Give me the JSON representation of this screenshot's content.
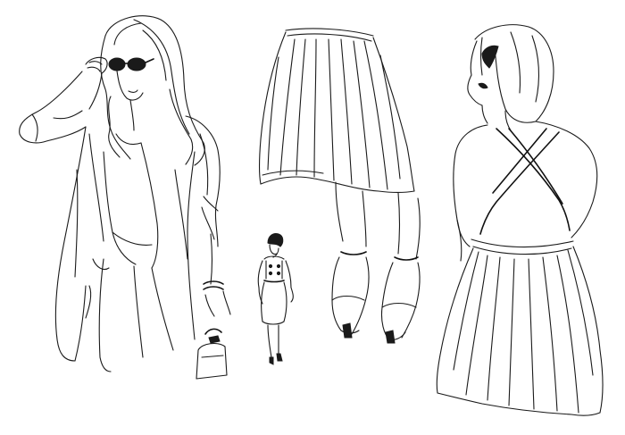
{
  "illustration": {
    "style": "fashion line sketch",
    "ink_color": "#1a1a1a",
    "background_color": "#ffffff",
    "figures": [
      {
        "id": "woman-with-sunglasses",
        "icon": "sunglasses-woman-figure"
      },
      {
        "id": "small-walking-figure",
        "icon": "walking-woman-figure"
      },
      {
        "id": "skirt-and-heels",
        "icon": "pleated-skirt-legs"
      },
      {
        "id": "woman-back-view-dress",
        "icon": "cross-back-dress-figure"
      }
    ]
  }
}
